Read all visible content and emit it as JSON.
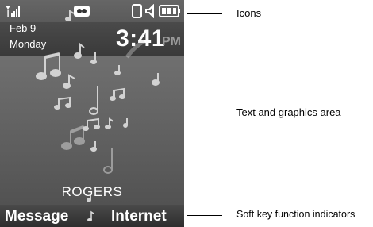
{
  "status": {
    "icons": [
      "signal-icon",
      "carrier-icon",
      "sim-icon",
      "speaker-icon",
      "battery-icon"
    ]
  },
  "header": {
    "date": "Feb 9",
    "weekday": "Monday",
    "time": "3:41",
    "ampm": "PM"
  },
  "wallpaper": {
    "theme": "music-notes"
  },
  "carrier": {
    "name": "ROGERS"
  },
  "softkeys": {
    "left": "Message",
    "right": "Internet"
  },
  "callouts": {
    "icons": "Icons",
    "display_area": "Text and graphics area",
    "softkey_indicators": "Soft key function indicators"
  },
  "colors": {
    "phone_bg": "#6b6b6b",
    "text": "#ffffff",
    "ampm": "#9a9a9a"
  }
}
